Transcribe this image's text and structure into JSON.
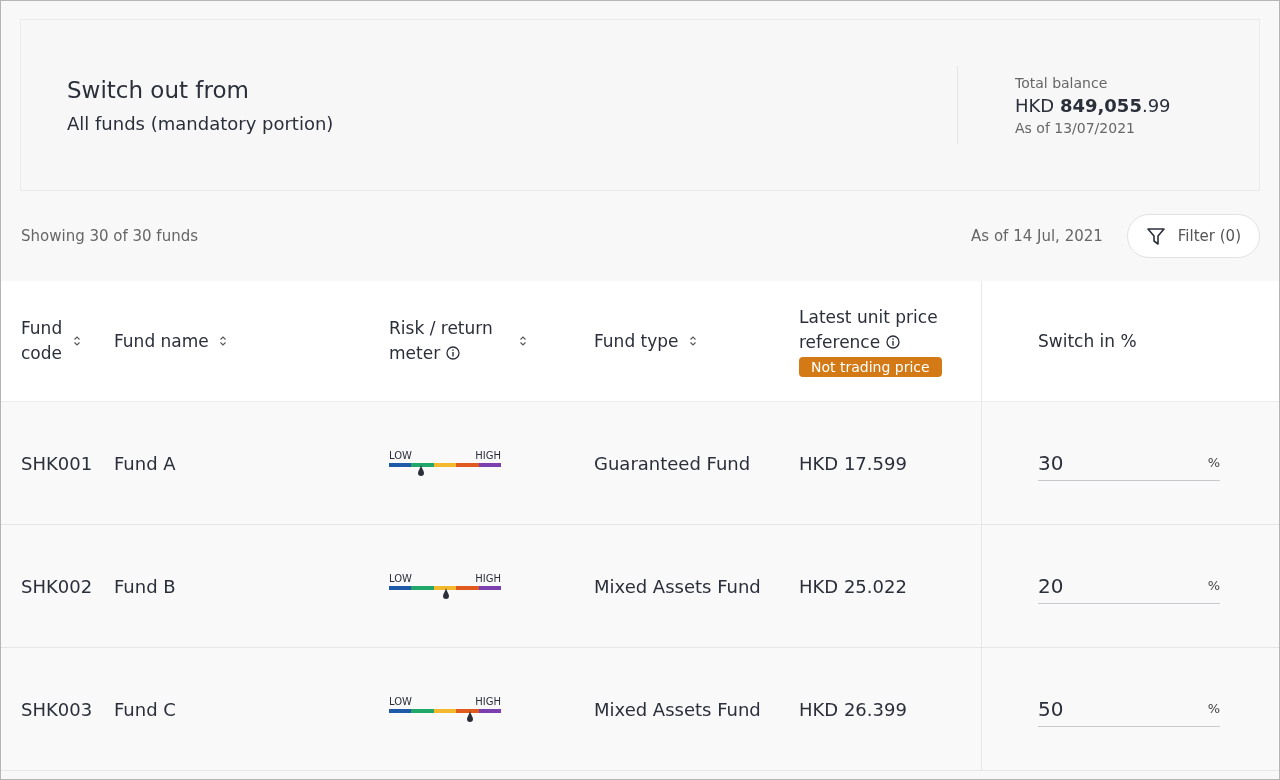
{
  "summary": {
    "title": "Switch out from",
    "subtitle": "All funds (mandatory portion)",
    "balance_label": "Total balance",
    "balance": "HKD **849,055**.99",
    "balance_date": "As of 13/07/2021"
  },
  "toolbar": {
    "count": "Showing 30 of 30 funds",
    "date": "As of 14 Jul, 2021",
    "filter_button": "Filter (0)"
  },
  "table": {
    "columns": [
      {
        "label": "Fund code",
        "sortable": true,
        "info": false
      },
      {
        "label": "Fund name",
        "sortable": true,
        "info": false
      },
      {
        "label": "Risk / return meter",
        "sortable": true,
        "info": true
      },
      {
        "label": "Fund type",
        "sortable": true,
        "info": false
      },
      {
        "label": "Latest unit price reference",
        "sortable": false,
        "info": true,
        "badge": "Not trading price"
      },
      {
        "label": "Switch in %",
        "sortable": false,
        "info": false
      }
    ],
    "rows": [
      {
        "code": "SHK001",
        "name": "Fund A",
        "risk": {
          "low": "LOW",
          "high": "HIGH",
          "level": 0.29
        },
        "type": "Guaranteed Fund",
        "price": "HKD 17.599",
        "switch": "30",
        "unit": "%"
      },
      {
        "code": "SHK002",
        "name": "Fund B",
        "risk": {
          "low": "LOW",
          "high": "HIGH",
          "level": 0.51
        },
        "type": "Mixed Assets Fund",
        "price": "HKD 25.022",
        "switch": "20",
        "unit": "%"
      },
      {
        "code": "SHK003",
        "name": "Fund C",
        "risk": {
          "low": "LOW",
          "high": "HIGH",
          "level": 0.72
        },
        "type": "Mixed Assets Fund",
        "price": "HKD 26.399",
        "switch": "50",
        "unit": "%"
      }
    ]
  }
}
